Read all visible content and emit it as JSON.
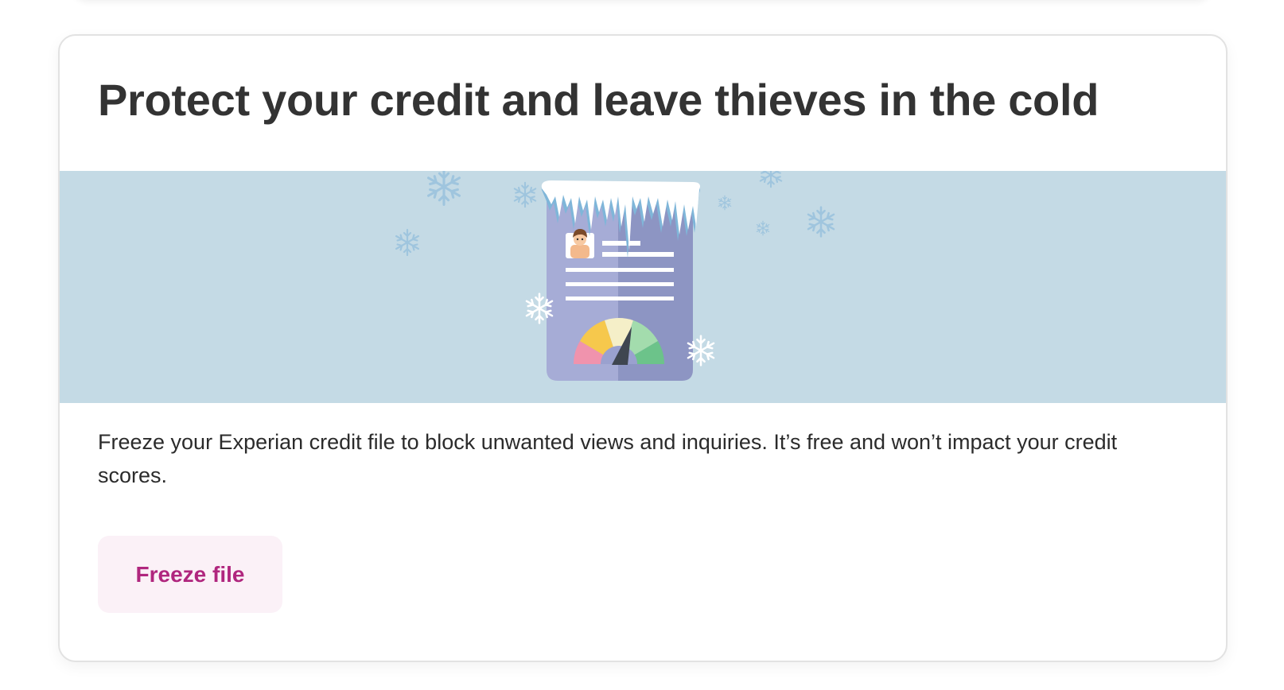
{
  "card": {
    "title": "Protect your credit and leave thieves in the cold",
    "description": "Freeze your Experian credit file to block unwanted views and inquiries. It’s free and won’t impact your credit scores.",
    "button_label": "Freeze file"
  },
  "illustration": {
    "name": "frozen-credit-report-illustration",
    "icons": [
      "snowflake-icon",
      "credit-report-icon",
      "credit-score-gauge-icon",
      "person-avatar-icon"
    ]
  },
  "colors": {
    "banner_background": "#c4dae5",
    "button_background": "#fbf1f7",
    "button_text": "#b0267e",
    "title_text": "#333333",
    "report_left": "#a6acd6",
    "report_right": "#8d95c3",
    "gauge_red": "#f093ad",
    "gauge_yellow": "#f6c84c",
    "gauge_cream": "#f5efc8",
    "gauge_lightgreen": "#a3dcad",
    "gauge_green": "#6cc38a"
  }
}
